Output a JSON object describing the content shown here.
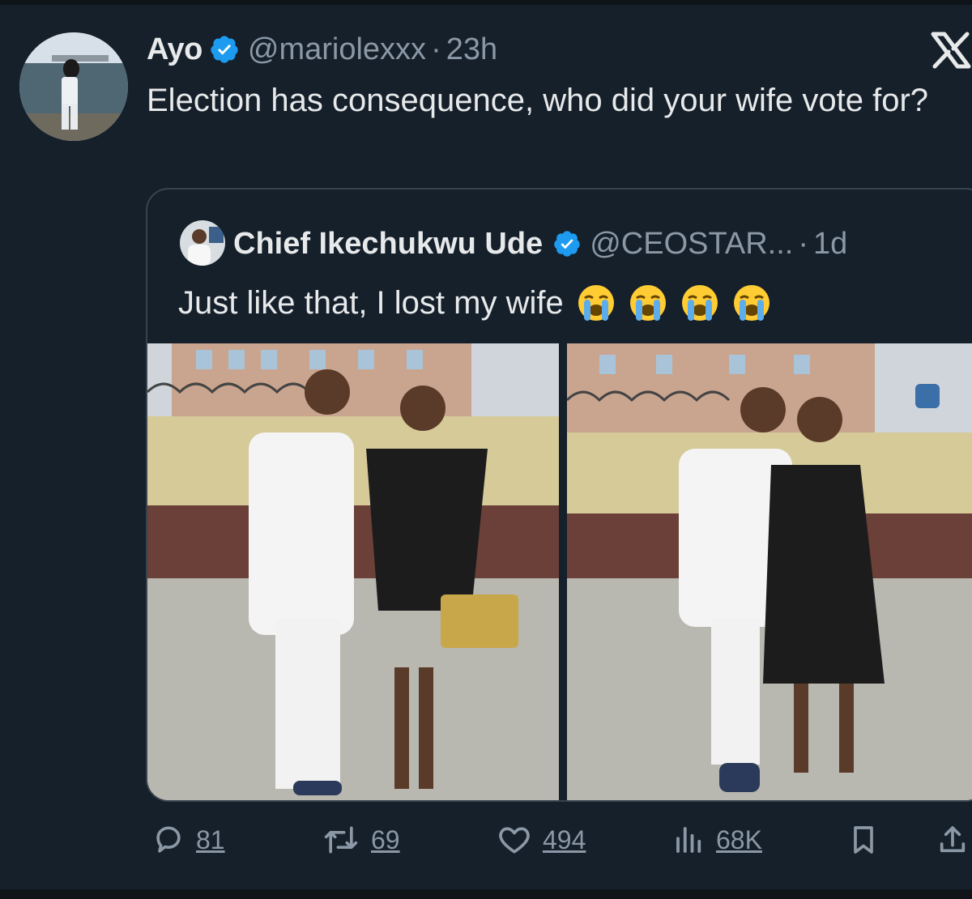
{
  "tweet": {
    "author_name": "Ayo",
    "author_handle": "@mariolexxx",
    "separator": "·",
    "timestamp": "23h",
    "text": "Election has consequence, who did your wife vote for?"
  },
  "quoted_tweet": {
    "author_name": "Chief Ikechukwu Ude",
    "author_handle": "@CEOSTAR...",
    "separator": "·",
    "timestamp": "1d",
    "text": "Just like that, I lost my wife",
    "emojis": [
      "loudly-crying-face",
      "loudly-crying-face",
      "loudly-crying-face",
      "loudly-crying-face"
    ]
  },
  "actions": {
    "reply_count": "81",
    "repost_count": "69",
    "like_count": "494",
    "views_count": "68K"
  },
  "icons": {
    "verified": "verified-badge-icon",
    "brand": "x-logo-icon",
    "reply": "reply-icon",
    "repost": "repost-icon",
    "like": "heart-icon",
    "views": "views-icon",
    "bookmark": "bookmark-icon",
    "share": "share-icon"
  },
  "colors": {
    "background": "#15202b",
    "primary_text": "#e7e9ea",
    "secondary_text": "#8b98a5",
    "verified_blue": "#1d9bf0",
    "border": "#38444d"
  }
}
